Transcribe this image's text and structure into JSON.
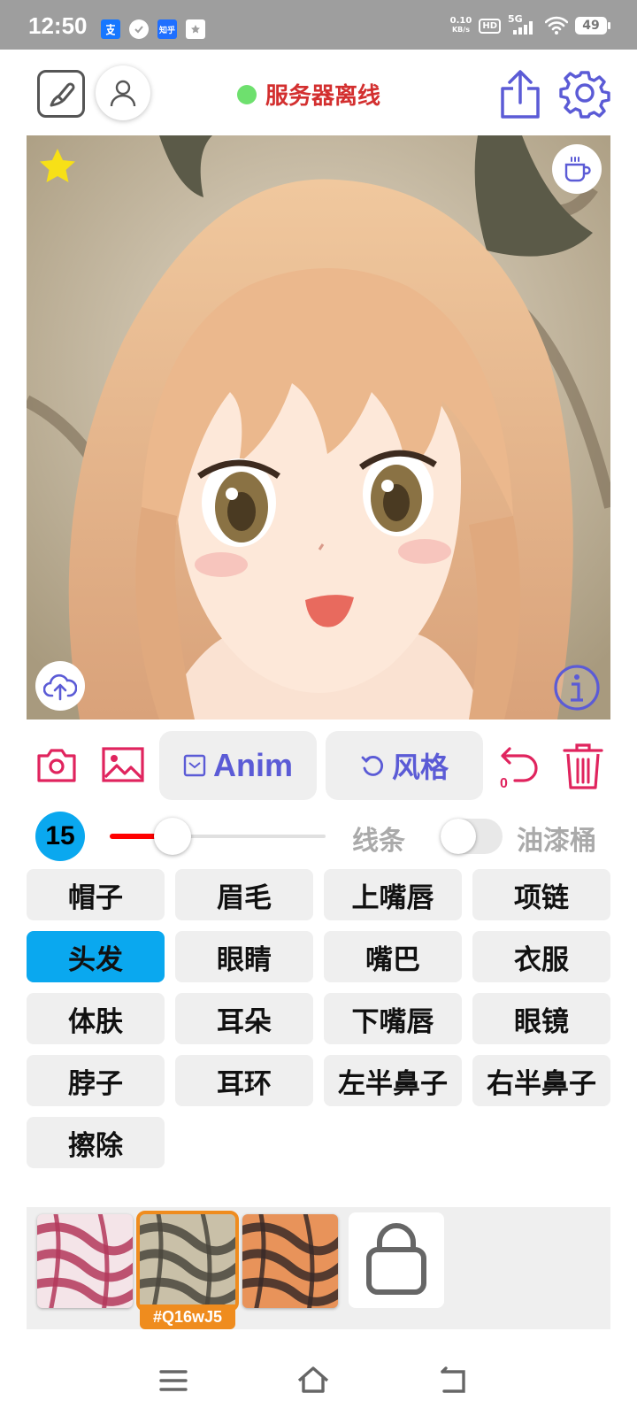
{
  "status_bar": {
    "time": "12:50",
    "notifications": [
      {
        "icon": "alipay-icon",
        "color": "#1677ff"
      },
      {
        "icon": "check-badge-icon",
        "color": "#ffffff"
      },
      {
        "icon": "zhihu-icon",
        "color": "#1f6fff",
        "text": "知乎"
      },
      {
        "icon": "star-app-icon",
        "color": "#ffffff"
      }
    ],
    "net_speed_value": "0.10",
    "net_speed_unit": "KB/s",
    "hd_label": "HD",
    "signal_label": "5G",
    "battery": "49"
  },
  "top_bar": {
    "server_status": "服务器离线",
    "status_color": "#6ee06e"
  },
  "action_row": {
    "anim_label": "Anim",
    "style_label": "风格"
  },
  "brush": {
    "size": "15",
    "slider_fraction": 0.29,
    "line_label": "线条",
    "bucket_label": "油漆桶",
    "bucket_enabled": false
  },
  "segments": [
    {
      "label": "帽子",
      "active": false
    },
    {
      "label": "眉毛",
      "active": false
    },
    {
      "label": "上嘴唇",
      "active": false
    },
    {
      "label": "项链",
      "active": false
    },
    {
      "label": "头发",
      "active": true
    },
    {
      "label": "眼睛",
      "active": false
    },
    {
      "label": "嘴巴",
      "active": false
    },
    {
      "label": "衣服",
      "active": false
    },
    {
      "label": "体肤",
      "active": false
    },
    {
      "label": "耳朵",
      "active": false
    },
    {
      "label": "下嘴唇",
      "active": false
    },
    {
      "label": "眼镜",
      "active": false
    },
    {
      "label": "脖子",
      "active": false
    },
    {
      "label": "耳环",
      "active": false
    },
    {
      "label": "左半鼻子",
      "active": false
    },
    {
      "label": "右半鼻子",
      "active": false
    },
    {
      "label": "擦除",
      "active": false
    }
  ],
  "palette": {
    "selected_code": "#Q16wJ5",
    "swatches": [
      {
        "name": "pattern-magenta",
        "base": "#f4e4e8",
        "stroke": "#b3385a"
      },
      {
        "name": "pattern-olive",
        "base": "#c9c0a8",
        "stroke": "#4a473d"
      },
      {
        "name": "pattern-orange",
        "base": "#e8935a",
        "stroke": "#3a2a28"
      }
    ]
  },
  "colors": {
    "accent_blue": "#0aa8ef",
    "icon_purple": "#5b5bd6",
    "icon_red": "#e0245e",
    "offline_red": "#d32f2f",
    "selected_orange": "#ef8c1e"
  }
}
